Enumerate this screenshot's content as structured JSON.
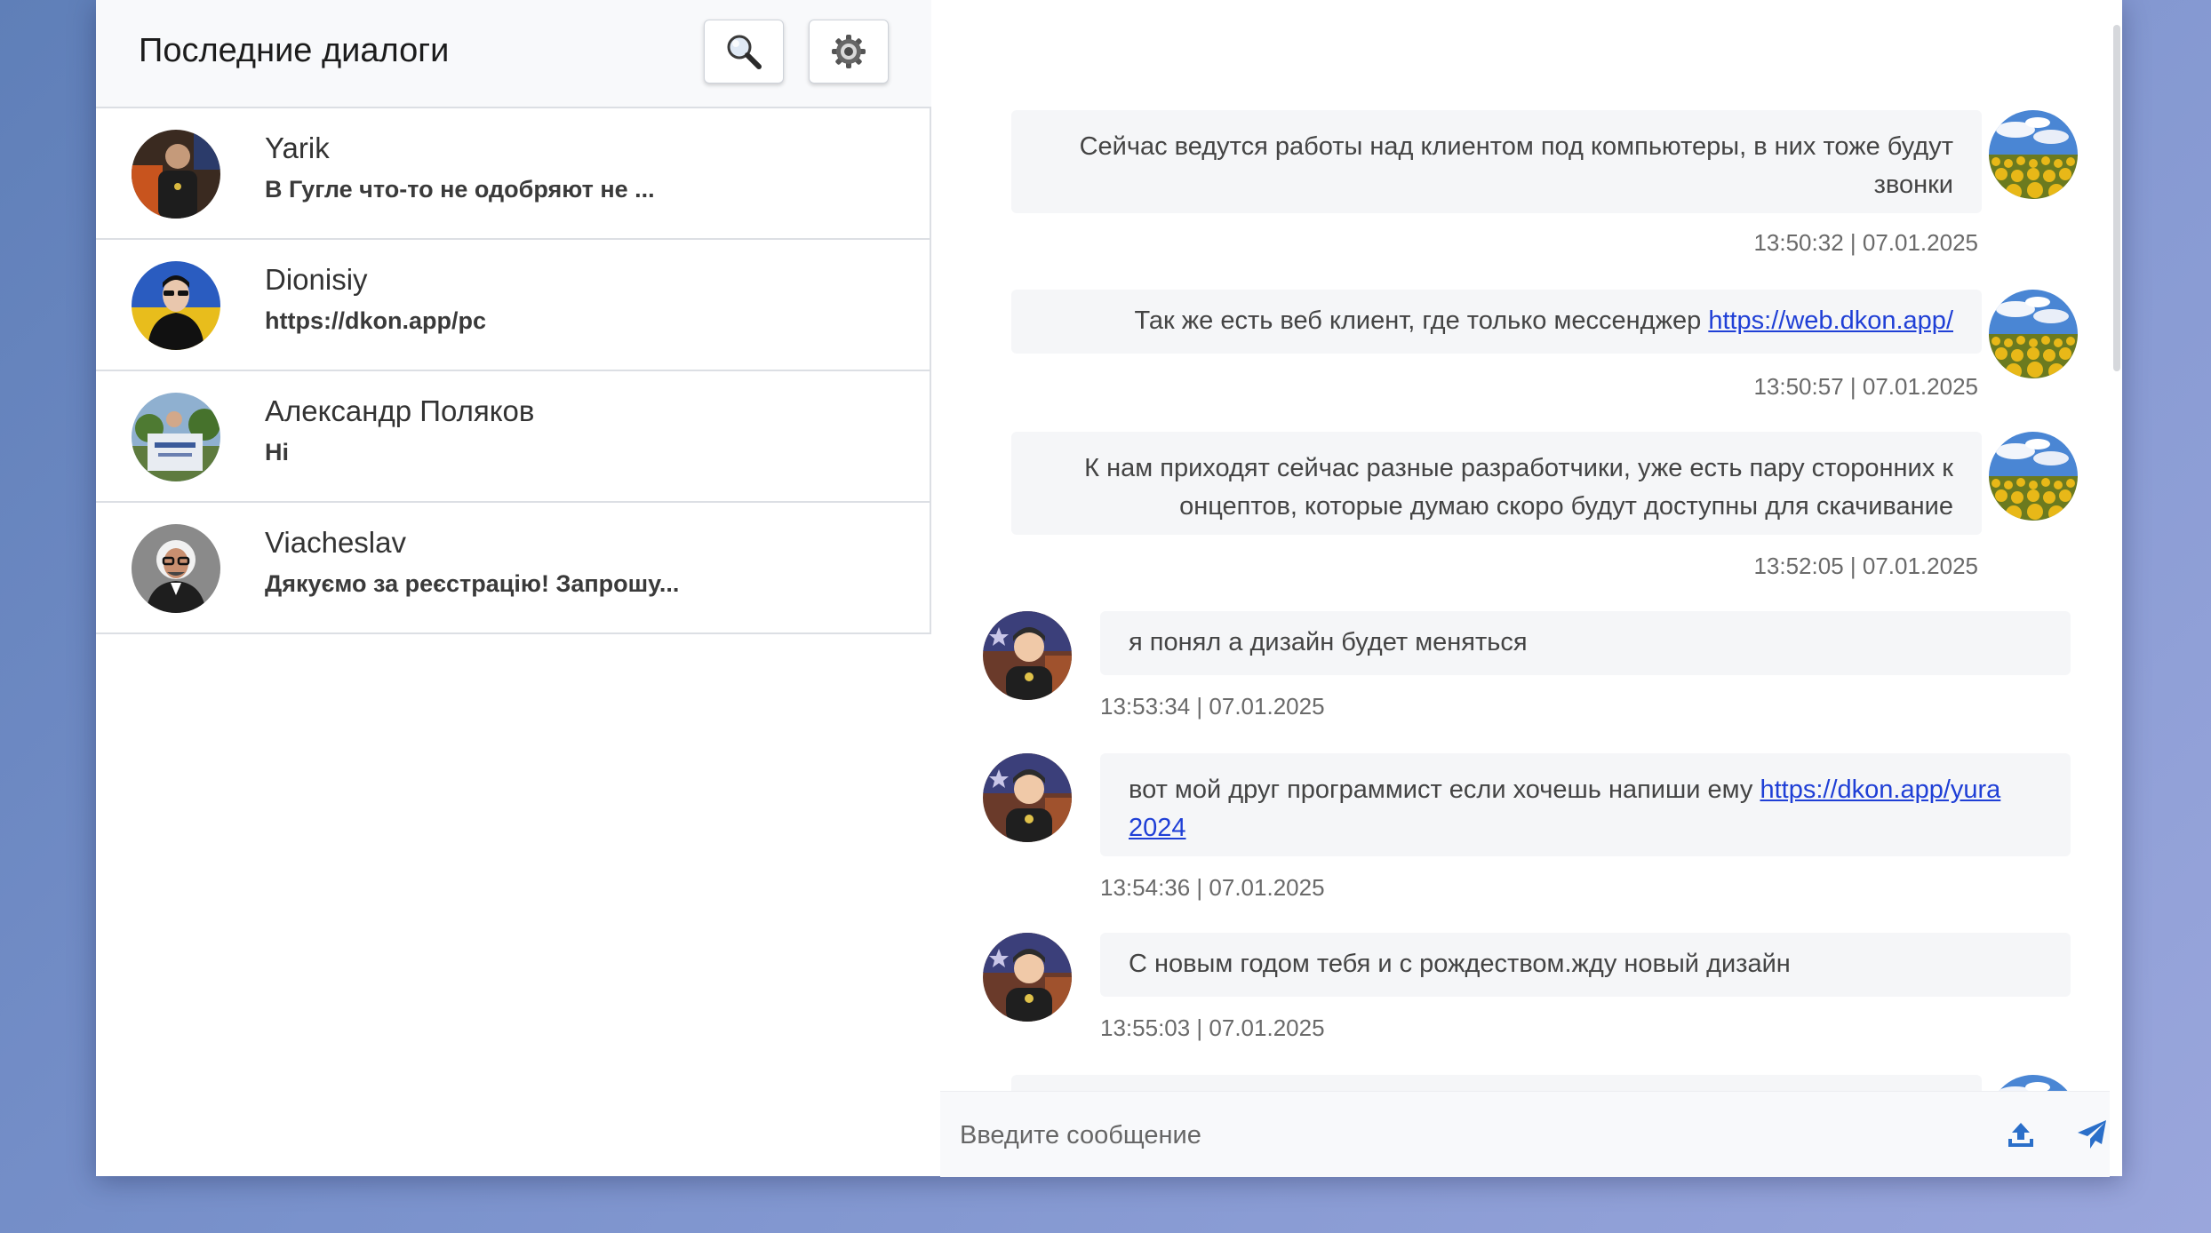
{
  "sidebar": {
    "title": "Последние диалоги",
    "search_icon": "search-icon",
    "settings_icon": "gear-icon",
    "dialogs": [
      {
        "name": "Yarik",
        "preview": "В Гугле что-то не одобряют не ...",
        "avatar": "yarik-avatar"
      },
      {
        "name": "Dionisiy",
        "preview": "https://dkon.app/pc",
        "avatar": "dionisiy-avatar"
      },
      {
        "name": "Александр Поляков",
        "preview": "Hi",
        "avatar": "polyakov-avatar"
      },
      {
        "name": "Viacheslav",
        "preview": "Дякуємо за реєстрацію! Запрошу...",
        "avatar": "viacheslav-avatar"
      }
    ]
  },
  "chat": {
    "messages": [
      {
        "direction": "out",
        "text_line1": "Сейчас ведутся работы над клиентом под компьютеры, в них тоже будут",
        "text_line2": "звонки",
        "time": "13:50:32 | 07.01.2025"
      },
      {
        "direction": "out",
        "text": "Так же есть веб клиент, где только мессенджер ",
        "link": "https://web.dkon.app/",
        "time": "13:50:57 | 07.01.2025"
      },
      {
        "direction": "out",
        "text_line1": "К нам приходят сейчас разные разработчики, уже есть пару сторонних к",
        "text_line2": "онцептов, которые думаю скоро будут доступны для скачивание",
        "time": "13:52:05 | 07.01.2025"
      },
      {
        "direction": "in",
        "text": "я понял а дизайн будет меняться",
        "time": "13:53:34 | 07.01.2025"
      },
      {
        "direction": "in",
        "text": "вот мой друг программист если хочешь напиши ему ",
        "link_line1": "https://dkon.app/yura",
        "link_line2": "2024",
        "time": "13:54:36 | 07.01.2025"
      },
      {
        "direction": "in",
        "text": "С новым годом тебя и с рождеством.жду новый дизайн",
        "time": "13:55:03 | 07.01.2025"
      }
    ],
    "input_placeholder": "Введите сообщение",
    "upload_icon": "upload-icon",
    "send_icon": "send-icon"
  }
}
